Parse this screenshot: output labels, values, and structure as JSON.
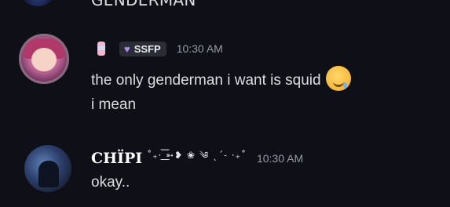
{
  "cutoff_message": {
    "text": "GENDERMAN"
  },
  "messages": [
    {
      "tag_label": "SSFP",
      "timestamp": "10:30 AM",
      "lines": [
        "the only genderman i want is squid",
        "i mean"
      ],
      "emoji": "drooling-face"
    },
    {
      "username": "CHÏPI",
      "decoration": "˚₊· ͟͟͞͞➳❥ ❀ ༄ ˎˊ˗ ·₊˚",
      "timestamp": "10:30 AM",
      "lines": [
        "okay.."
      ]
    }
  ]
}
